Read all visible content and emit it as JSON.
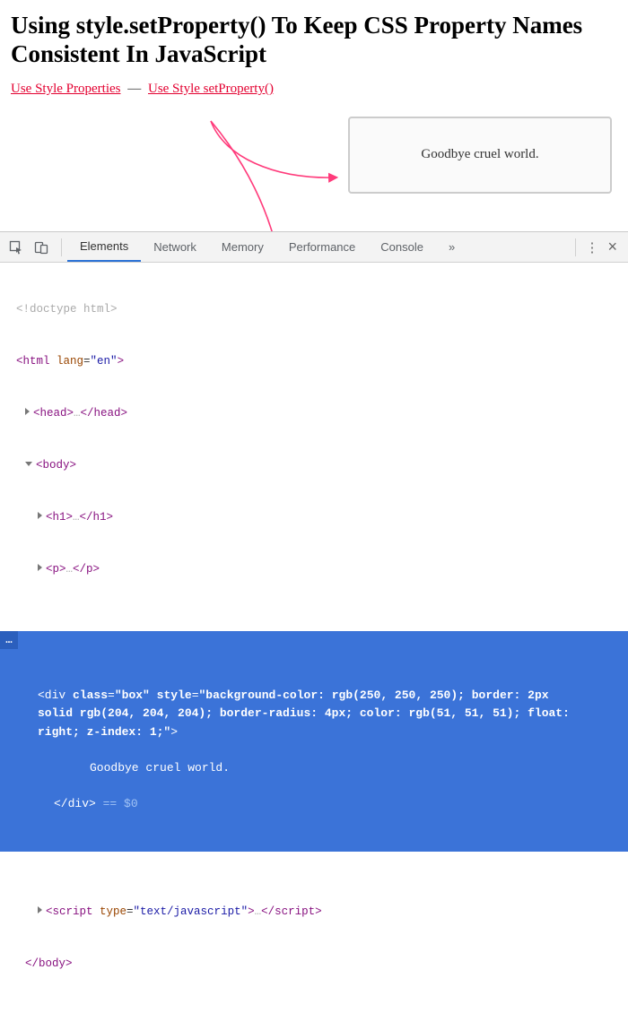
{
  "title": "Using style.setProperty() To Keep CSS Property Names Consistent In JavaScript",
  "links": {
    "a": "Use Style Properties",
    "sep": "—",
    "b": "Use Style setProperty()"
  },
  "box": {
    "text": "Goodbye cruel world."
  },
  "devtools": {
    "tabs": {
      "elements": "Elements",
      "network": "Network",
      "memory": "Memory",
      "performance": "Performance",
      "console": "Console",
      "overflow": "»"
    },
    "menu_dots": "⋮",
    "close": "×"
  },
  "dom": {
    "doctype": "<!doctype html>",
    "html_open": "<html lang=\"en\">",
    "head": "<head>…</head>",
    "body_open": "<body>",
    "h1": "<h1>…</h1>",
    "p": "<p>…</p>",
    "selected": {
      "gutter": "…",
      "line1": "<div class=\"box\" style=\"background-color: rgb(250, 250, 250); border: 2px solid rgb(204, 204, 204); border-radius: 4px; color: rgb(51, 51, 51); float: right; z-index: 1;\">",
      "text": "Goodbye cruel world.",
      "close": "</div>",
      "eq0": " == $0"
    },
    "script": "<script type=\"text/javascript\">…</",
    "script_suffix": "script>",
    "body_close": "</body>"
  }
}
